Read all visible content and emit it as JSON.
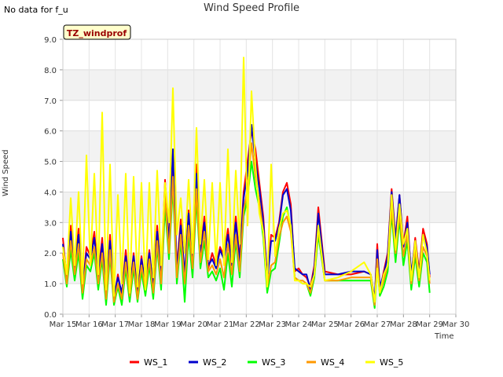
{
  "page": {
    "no_data_note": "No data for f_u"
  },
  "chart_data": {
    "type": "line",
    "title": "Wind Speed Profile",
    "xlabel": "Time",
    "ylabel": "Wind Speed",
    "site_badge": "TZ_windprof",
    "ylim": [
      0.0,
      9.0
    ],
    "yticks": [
      "0.0",
      "1.0",
      "2.0",
      "3.0",
      "4.0",
      "5.0",
      "6.0",
      "7.0",
      "8.0",
      "9.0"
    ],
    "xlim": [
      0,
      15
    ],
    "xtick_labels": [
      "Mar 15",
      "Mar 16",
      "Mar 17",
      "Mar 18",
      "Mar 19",
      "Mar 20",
      "Mar 21",
      "Mar 22",
      "Mar 23",
      "Mar 24",
      "Mar 25",
      "Mar 26",
      "Mar 27",
      "Mar 28",
      "Mar 29",
      "Mar 30"
    ],
    "x_units": "days since Mar 15",
    "grid": true,
    "band_colors": [
      "#ffffff",
      "#f2f2f2"
    ],
    "legend_position": "bottom",
    "series": [
      {
        "name": "WS_1",
        "color": "#ff0000",
        "x": [
          0.0,
          0.15,
          0.3,
          0.45,
          0.6,
          0.75,
          0.9,
          1.05,
          1.2,
          1.35,
          1.5,
          1.65,
          1.8,
          1.95,
          2.1,
          2.25,
          2.4,
          2.55,
          2.7,
          2.85,
          3.0,
          3.15,
          3.3,
          3.45,
          3.6,
          3.75,
          3.9,
          4.05,
          4.2,
          4.35,
          4.5,
          4.65,
          4.8,
          4.95,
          5.1,
          5.25,
          5.4,
          5.55,
          5.7,
          5.85,
          6.0,
          6.15,
          6.3,
          6.45,
          6.6,
          6.75,
          6.9,
          7.05,
          7.2,
          7.35,
          7.5,
          7.65,
          7.8,
          7.95,
          8.1,
          8.25,
          8.4,
          8.55,
          8.7,
          8.85,
          9.0,
          9.15,
          9.3,
          9.45,
          9.6,
          9.75,
          10.0,
          10.5,
          11.0,
          11.5,
          11.75,
          11.9,
          12.0,
          12.1,
          12.25,
          12.4,
          12.55,
          12.7,
          12.85,
          13.0,
          13.15,
          13.3,
          13.45,
          13.6,
          13.75,
          13.9,
          14.0
        ],
        "y": [
          2.5,
          1.1,
          2.9,
          1.6,
          2.8,
          0.8,
          2.2,
          1.9,
          2.7,
          1.3,
          2.5,
          0.6,
          2.6,
          0.5,
          1.3,
          0.6,
          2.1,
          0.7,
          2.0,
          0.6,
          1.9,
          0.9,
          2.1,
          0.8,
          2.9,
          1.2,
          4.4,
          2.4,
          4.8,
          1.5,
          3.1,
          1.2,
          3.4,
          1.8,
          4.9,
          2.0,
          3.2,
          1.5,
          2.0,
          1.6,
          2.2,
          1.9,
          2.8,
          1.7,
          3.2,
          1.8,
          4.0,
          5.0,
          6.0,
          5.4,
          4.3,
          3.2,
          1.2,
          2.6,
          2.5,
          3.0,
          4.0,
          4.3,
          3.6,
          1.4,
          1.5,
          1.3,
          1.2,
          0.9,
          1.6,
          3.5,
          1.4,
          1.3,
          1.3,
          1.4,
          1.3,
          0.4,
          2.3,
          0.8,
          1.4,
          2.0,
          4.1,
          2.5,
          3.9,
          2.3,
          3.2,
          1.2,
          2.5,
          1.4,
          2.8,
          2.3,
          1.2
        ]
      },
      {
        "name": "WS_2",
        "color": "#0000cc",
        "x": [
          0.0,
          0.15,
          0.3,
          0.45,
          0.6,
          0.75,
          0.9,
          1.05,
          1.2,
          1.35,
          1.5,
          1.65,
          1.8,
          1.95,
          2.1,
          2.25,
          2.4,
          2.55,
          2.7,
          2.85,
          3.0,
          3.15,
          3.3,
          3.45,
          3.6,
          3.75,
          3.9,
          4.05,
          4.2,
          4.35,
          4.5,
          4.65,
          4.8,
          4.95,
          5.1,
          5.25,
          5.4,
          5.55,
          5.7,
          5.85,
          6.0,
          6.15,
          6.3,
          6.45,
          6.6,
          6.75,
          6.9,
          7.05,
          7.2,
          7.35,
          7.5,
          7.65,
          7.8,
          7.95,
          8.1,
          8.25,
          8.4,
          8.55,
          8.7,
          8.85,
          9.0,
          9.15,
          9.3,
          9.45,
          9.6,
          9.75,
          10.0,
          10.5,
          11.0,
          11.5,
          11.75,
          11.9,
          12.0,
          12.1,
          12.25,
          12.4,
          12.55,
          12.7,
          12.85,
          13.0,
          13.15,
          13.3,
          13.45,
          13.6,
          13.75,
          13.9,
          14.0
        ],
        "y": [
          2.3,
          1.2,
          2.7,
          1.5,
          2.6,
          0.9,
          2.0,
          1.8,
          2.5,
          1.2,
          2.3,
          0.7,
          2.4,
          0.6,
          1.2,
          0.7,
          1.9,
          0.8,
          1.9,
          0.7,
          1.8,
          1.0,
          2.0,
          0.9,
          2.7,
          1.3,
          4.2,
          2.3,
          5.4,
          1.4,
          2.9,
          1.3,
          3.3,
          1.7,
          4.6,
          1.9,
          3.0,
          1.6,
          1.8,
          1.5,
          2.1,
          1.8,
          2.6,
          1.6,
          3.0,
          1.7,
          3.8,
          4.6,
          6.2,
          5.0,
          4.1,
          3.0,
          1.1,
          2.4,
          2.4,
          2.9,
          3.9,
          4.1,
          3.4,
          1.5,
          1.4,
          1.3,
          1.3,
          0.8,
          1.5,
          3.3,
          1.3,
          1.3,
          1.4,
          1.4,
          1.3,
          0.5,
          2.1,
          0.9,
          1.3,
          1.9,
          4.0,
          2.4,
          3.9,
          2.2,
          3.0,
          1.3,
          2.4,
          1.3,
          2.6,
          2.2,
          1.3
        ]
      },
      {
        "name": "WS_3",
        "color": "#00ff00",
        "x": [
          0.0,
          0.15,
          0.3,
          0.45,
          0.6,
          0.75,
          0.9,
          1.05,
          1.2,
          1.35,
          1.5,
          1.65,
          1.8,
          1.95,
          2.1,
          2.25,
          2.4,
          2.55,
          2.7,
          2.85,
          3.0,
          3.15,
          3.3,
          3.45,
          3.6,
          3.75,
          3.9,
          4.05,
          4.2,
          4.35,
          4.5,
          4.65,
          4.8,
          4.95,
          5.1,
          5.25,
          5.4,
          5.55,
          5.7,
          5.85,
          6.0,
          6.15,
          6.3,
          6.45,
          6.6,
          6.75,
          6.9,
          7.05,
          7.2,
          7.35,
          7.5,
          7.65,
          7.8,
          7.95,
          8.1,
          8.25,
          8.4,
          8.55,
          8.7,
          8.85,
          9.0,
          9.15,
          9.3,
          9.45,
          9.6,
          9.75,
          10.0,
          10.5,
          11.0,
          11.5,
          11.75,
          11.9,
          12.0,
          12.1,
          12.25,
          12.4,
          12.55,
          12.7,
          12.85,
          13.0,
          13.15,
          13.3,
          13.45,
          13.6,
          13.75,
          13.9,
          14.0
        ],
        "y": [
          1.8,
          0.9,
          2.1,
          1.1,
          2.0,
          0.5,
          1.6,
          1.4,
          2.0,
          0.8,
          1.8,
          0.3,
          1.9,
          0.3,
          0.9,
          0.3,
          1.5,
          0.4,
          1.5,
          0.4,
          1.4,
          0.6,
          1.6,
          0.5,
          2.2,
          0.8,
          3.5,
          1.8,
          4.2,
          1.0,
          2.4,
          0.4,
          2.6,
          1.2,
          3.8,
          1.5,
          2.4,
          1.2,
          1.4,
          1.1,
          1.5,
          0.8,
          2.0,
          0.9,
          2.4,
          1.2,
          3.2,
          3.8,
          5.0,
          4.1,
          3.5,
          2.5,
          0.7,
          1.4,
          1.5,
          2.3,
          3.2,
          3.5,
          2.8,
          1.2,
          1.1,
          1.0,
          1.0,
          0.6,
          1.2,
          2.6,
          1.1,
          1.1,
          1.1,
          1.1,
          1.1,
          0.2,
          1.6,
          0.6,
          0.9,
          1.4,
          3.3,
          1.7,
          3.1,
          1.6,
          2.4,
          0.8,
          1.9,
          0.9,
          2.0,
          1.7,
          0.7
        ]
      },
      {
        "name": "WS_4",
        "color": "#ff9900",
        "x": [
          0.0,
          0.15,
          0.3,
          0.45,
          0.6,
          0.75,
          0.9,
          1.05,
          1.2,
          1.35,
          1.5,
          1.65,
          1.8,
          1.95,
          2.1,
          2.25,
          2.4,
          2.55,
          2.7,
          2.85,
          3.0,
          3.15,
          3.3,
          3.45,
          3.6,
          3.75,
          3.9,
          4.05,
          4.2,
          4.35,
          4.5,
          4.65,
          4.8,
          4.95,
          5.1,
          5.25,
          5.4,
          5.55,
          5.7,
          5.85,
          6.0,
          6.15,
          6.3,
          6.45,
          6.6,
          6.75,
          6.9,
          7.05,
          7.2,
          7.35,
          7.5,
          7.65,
          7.8,
          7.95,
          8.1,
          8.25,
          8.4,
          8.55,
          8.7,
          8.85,
          9.0,
          9.15,
          9.3,
          9.45,
          9.6,
          9.75,
          10.0,
          10.5,
          11.0,
          11.5,
          11.75,
          11.9,
          12.0,
          12.1,
          12.25,
          12.4,
          12.55,
          12.7,
          12.85,
          13.0,
          13.15,
          13.3,
          13.45,
          13.6,
          13.75,
          13.9,
          14.0
        ],
        "y": [
          2.0,
          1.0,
          2.4,
          1.3,
          2.3,
          0.7,
          1.8,
          1.6,
          2.2,
          1.0,
          2.0,
          0.5,
          2.1,
          0.4,
          1.0,
          0.5,
          1.7,
          0.6,
          1.7,
          0.5,
          1.6,
          0.8,
          1.8,
          0.7,
          2.4,
          1.0,
          3.9,
          2.0,
          4.5,
          1.2,
          2.6,
          1.0,
          2.9,
          1.5,
          4.1,
          1.7,
          2.7,
          1.4,
          1.6,
          1.3,
          1.8,
          1.2,
          2.3,
          1.3,
          2.6,
          1.4,
          3.4,
          4.1,
          5.6,
          4.5,
          3.7,
          2.7,
          0.9,
          1.6,
          1.7,
          2.5,
          3.0,
          3.2,
          2.7,
          1.2,
          1.1,
          1.1,
          1.0,
          0.7,
          1.3,
          2.8,
          1.1,
          1.1,
          1.2,
          1.2,
          1.2,
          0.3,
          1.8,
          0.7,
          1.1,
          1.6,
          3.5,
          2.0,
          3.3,
          1.9,
          2.6,
          1.0,
          2.1,
          1.1,
          2.2,
          1.9,
          1.0
        ]
      },
      {
        "name": "WS_5",
        "color": "#ffff00",
        "x": [
          0.0,
          0.15,
          0.3,
          0.45,
          0.6,
          0.75,
          0.9,
          1.05,
          1.2,
          1.35,
          1.5,
          1.65,
          1.8,
          1.95,
          2.1,
          2.25,
          2.4,
          2.55,
          2.7,
          2.85,
          3.0,
          3.15,
          3.3,
          3.45,
          3.6,
          3.75,
          3.9,
          4.05,
          4.2,
          4.35,
          4.5,
          4.65,
          4.8,
          4.95,
          5.1,
          5.25,
          5.4,
          5.55,
          5.7,
          5.85,
          6.0,
          6.15,
          6.3,
          6.45,
          6.6,
          6.75,
          6.9,
          7.05,
          7.2,
          7.35,
          7.5,
          7.65,
          7.8,
          7.95,
          8.1,
          8.25,
          8.4,
          8.55,
          8.7,
          8.85,
          9.0,
          9.15,
          9.3,
          9.45,
          9.6,
          9.75,
          10.0,
          10.5,
          11.0,
          11.5,
          11.75,
          11.9,
          12.0,
          12.1,
          12.25,
          12.4,
          12.55,
          12.7,
          12.85,
          13.0,
          13.15,
          13.3,
          13.45,
          13.6,
          13.75,
          13.9,
          14.0
        ],
        "y": [
          2.2,
          1.3,
          3.8,
          1.6,
          4.0,
          1.0,
          5.2,
          1.6,
          4.6,
          1.3,
          6.6,
          0.8,
          4.9,
          0.6,
          3.9,
          1.0,
          4.6,
          0.7,
          4.5,
          0.9,
          4.3,
          0.8,
          4.3,
          1.2,
          4.7,
          1.6,
          4.3,
          3.0,
          7.4,
          2.6,
          3.8,
          2.0,
          4.4,
          2.0,
          6.1,
          2.3,
          4.4,
          1.8,
          4.3,
          1.6,
          4.3,
          1.6,
          5.4,
          1.7,
          4.7,
          2.3,
          8.4,
          2.9,
          7.3,
          4.9,
          3.3,
          2.7,
          0.9,
          4.9,
          1.9,
          2.8,
          3.3,
          3.4,
          2.9,
          1.1,
          1.1,
          1.0,
          1.0,
          0.9,
          1.3,
          2.9,
          1.1,
          1.2,
          1.4,
          1.7,
          1.3,
          0.4,
          1.5,
          0.7,
          1.3,
          1.6,
          3.9,
          2.1,
          3.6,
          2.3,
          2.8,
          1.1,
          2.4,
          1.2,
          2.6,
          2.0,
          1.1
        ]
      }
    ]
  }
}
